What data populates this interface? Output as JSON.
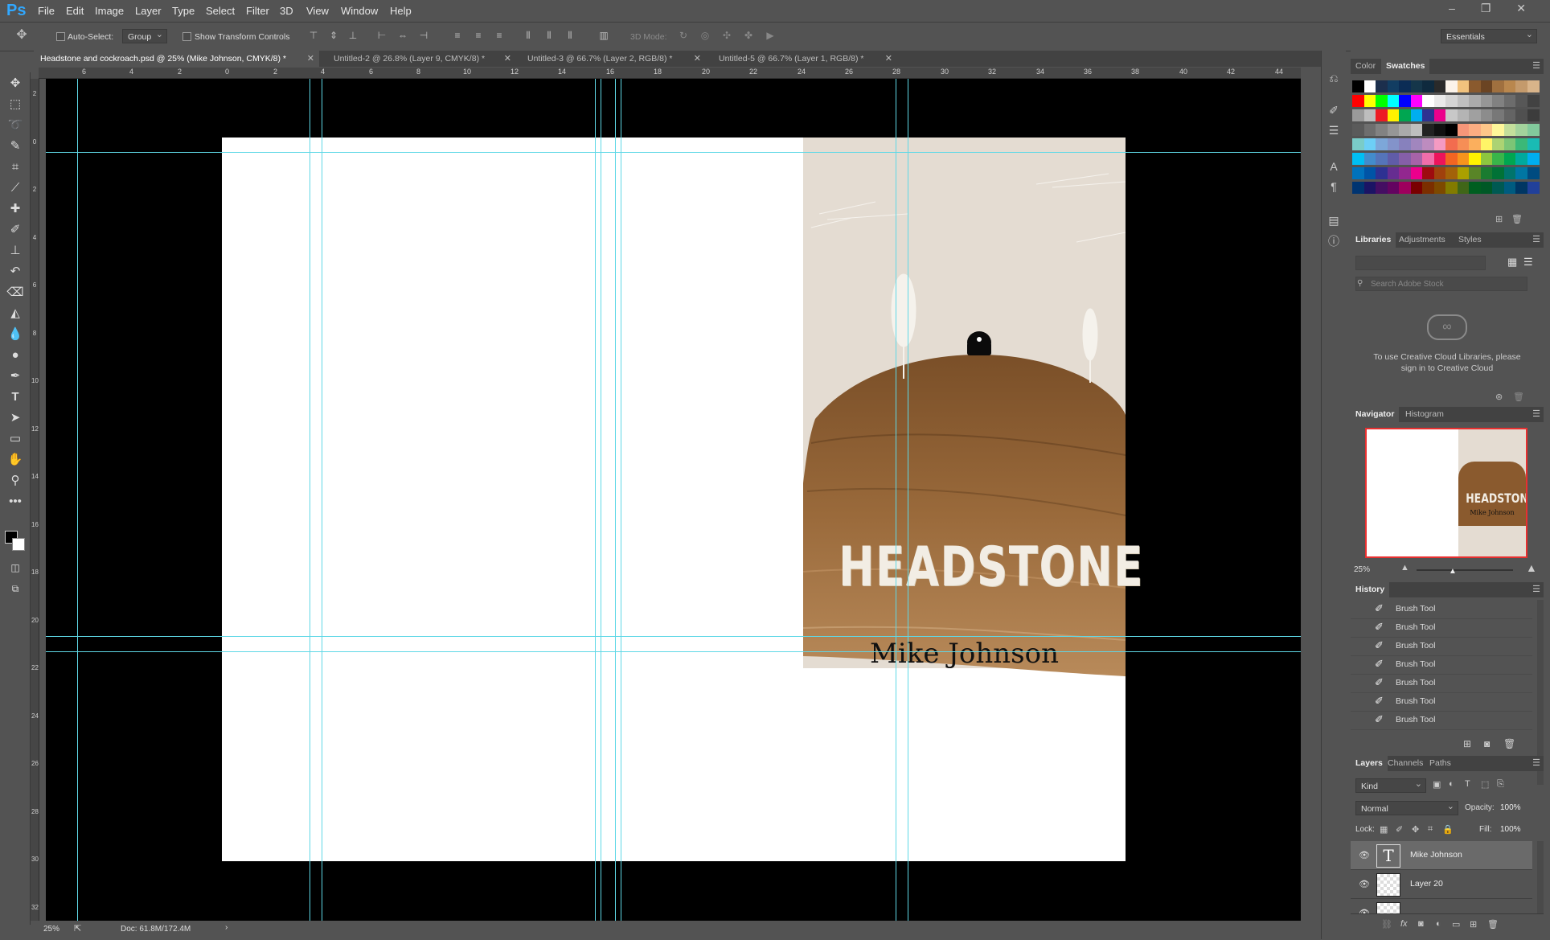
{
  "app": {
    "logo": "Ps",
    "window_controls": "–  ❐  ✕"
  },
  "menu": [
    "File",
    "Edit",
    "Image",
    "Layer",
    "Type",
    "Select",
    "Filter",
    "3D",
    "View",
    "Window",
    "Help"
  ],
  "options": {
    "auto_select_label": "Auto-Select:",
    "auto_select_value": "Group",
    "transform_label": "Show Transform Controls",
    "mode_3d_label": "3D Mode:",
    "workspace": "Essentials"
  },
  "tabs": [
    {
      "label": "Headstone and cockroach.psd @ 25% (Mike Johnson, CMYK/8) *",
      "active": true
    },
    {
      "label": "Untitled-2 @ 26.8% (Layer 9, CMYK/8) *",
      "active": false
    },
    {
      "label": "Untitled-3 @ 66.7% (Layer 2, RGB/8) *",
      "active": false
    },
    {
      "label": "Untitled-5 @ 66.7% (Layer 1, RGB/8) *",
      "active": false
    }
  ],
  "tools": [
    "move-icon",
    "marquee-icon",
    "lasso-icon",
    "quick-select-icon",
    "crop-icon",
    "eyedropper-icon",
    "healing-icon",
    "brush-icon",
    "stamp-icon",
    "history-brush-icon",
    "eraser-icon",
    "bucket-icon",
    "blur-icon",
    "dodge-icon",
    "pen-icon",
    "type-icon",
    "path-select-icon",
    "rectangle-icon",
    "hand-icon",
    "zoom-icon",
    "more-icon"
  ],
  "ruler_top": [
    "6",
    "4",
    "2",
    "0",
    "2",
    "4",
    "6",
    "8",
    "10",
    "12",
    "14",
    "16",
    "18",
    "20",
    "22",
    "24",
    "26",
    "28",
    "30",
    "32",
    "34",
    "36",
    "38",
    "40",
    "42",
    "44"
  ],
  "ruler_left": [
    "2",
    "0",
    "2",
    "4",
    "6",
    "8",
    "10",
    "12",
    "14",
    "16",
    "18",
    "20",
    "22",
    "24",
    "26",
    "28",
    "30",
    "32"
  ],
  "cover": {
    "title": "HEADSTONE",
    "author": "Mike Johnson"
  },
  "status": {
    "zoom": "25%",
    "doc": "Doc: 61.8M/172.4M"
  },
  "color_panel": {
    "tabs": [
      "Color",
      "Swatches"
    ],
    "active": "Swatches"
  },
  "libraries_panel": {
    "tabs": [
      "Libraries",
      "Adjustments",
      "Styles"
    ],
    "search_placeholder": "Search Adobe Stock",
    "message": "To use Creative Cloud Libraries, please sign in to Creative Cloud"
  },
  "navigator": {
    "tabs": [
      "Navigator",
      "Histogram"
    ],
    "zoom": "25%",
    "thumb_title": "HEADSTONE",
    "thumb_author": "Mike Johnson"
  },
  "history": {
    "title": "History",
    "items": [
      "Brush Tool",
      "Brush Tool",
      "Brush Tool",
      "Brush Tool",
      "Brush Tool",
      "Brush Tool",
      "Brush Tool"
    ]
  },
  "layers": {
    "tabs": [
      "Layers",
      "Channels",
      "Paths"
    ],
    "kind": "Kind",
    "blend": "Normal",
    "opacity_label": "Opacity:",
    "opacity": "100%",
    "lock_label": "Lock:",
    "fill_label": "Fill:",
    "fill": "100%",
    "items": [
      {
        "name": "Mike Johnson",
        "type": "text"
      },
      {
        "name": "Layer 20",
        "type": "pixel"
      }
    ]
  },
  "colors": {
    "accent": "#31a8ff",
    "guide": "#5fd8e6",
    "cover_bg": "#e4dcd2",
    "mound": "#8a5a2e"
  }
}
